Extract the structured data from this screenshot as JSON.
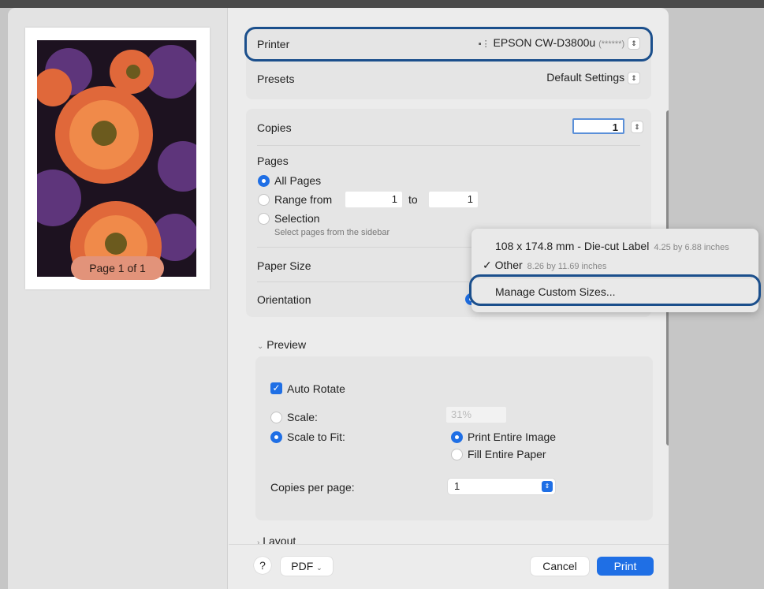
{
  "colors": {
    "accent": "#1f6fe5",
    "highlight_ring": "#1b4f8c",
    "page_pill": "#e2937a"
  },
  "sidebar": {
    "page_indicator": "Page 1 of 1"
  },
  "printer": {
    "label": "Printer",
    "value": "EPSON CW-D3800u",
    "masked": "(******)",
    "icon": "printer-icon"
  },
  "presets": {
    "label": "Presets",
    "value": "Default Settings"
  },
  "copies": {
    "label": "Copies",
    "value": "1"
  },
  "pages": {
    "label": "Pages",
    "all_pages": "All Pages",
    "range_from": "Range from",
    "range_start": "1",
    "range_to": "to",
    "range_end": "1",
    "selection": "Selection",
    "selection_hint": "Select pages from the sidebar"
  },
  "paper_size": {
    "label": "Paper Size"
  },
  "orientation": {
    "label": "Orientation"
  },
  "paper_menu": {
    "items": [
      {
        "label": "108 x 174.8 mm - Die-cut Label",
        "detail": "4.25 by 6.88 inches",
        "checked": false
      },
      {
        "label": "Other",
        "detail": "8.26 by 11.69 inches",
        "checked": true
      }
    ],
    "checkmark": "✓",
    "manage": "Manage Custom Sizes..."
  },
  "preview": {
    "header": "Preview",
    "auto_rotate": "Auto Rotate",
    "scale": "Scale:",
    "scale_value": "31%",
    "scale_to_fit": "Scale to Fit:",
    "print_entire_image": "Print Entire Image",
    "fill_entire_paper": "Fill Entire Paper",
    "copies_per_page": "Copies per page:",
    "copies_per_page_value": "1"
  },
  "layout": {
    "header": "Layout"
  },
  "footer": {
    "help": "?",
    "pdf": "PDF",
    "cancel": "Cancel",
    "print": "Print"
  }
}
